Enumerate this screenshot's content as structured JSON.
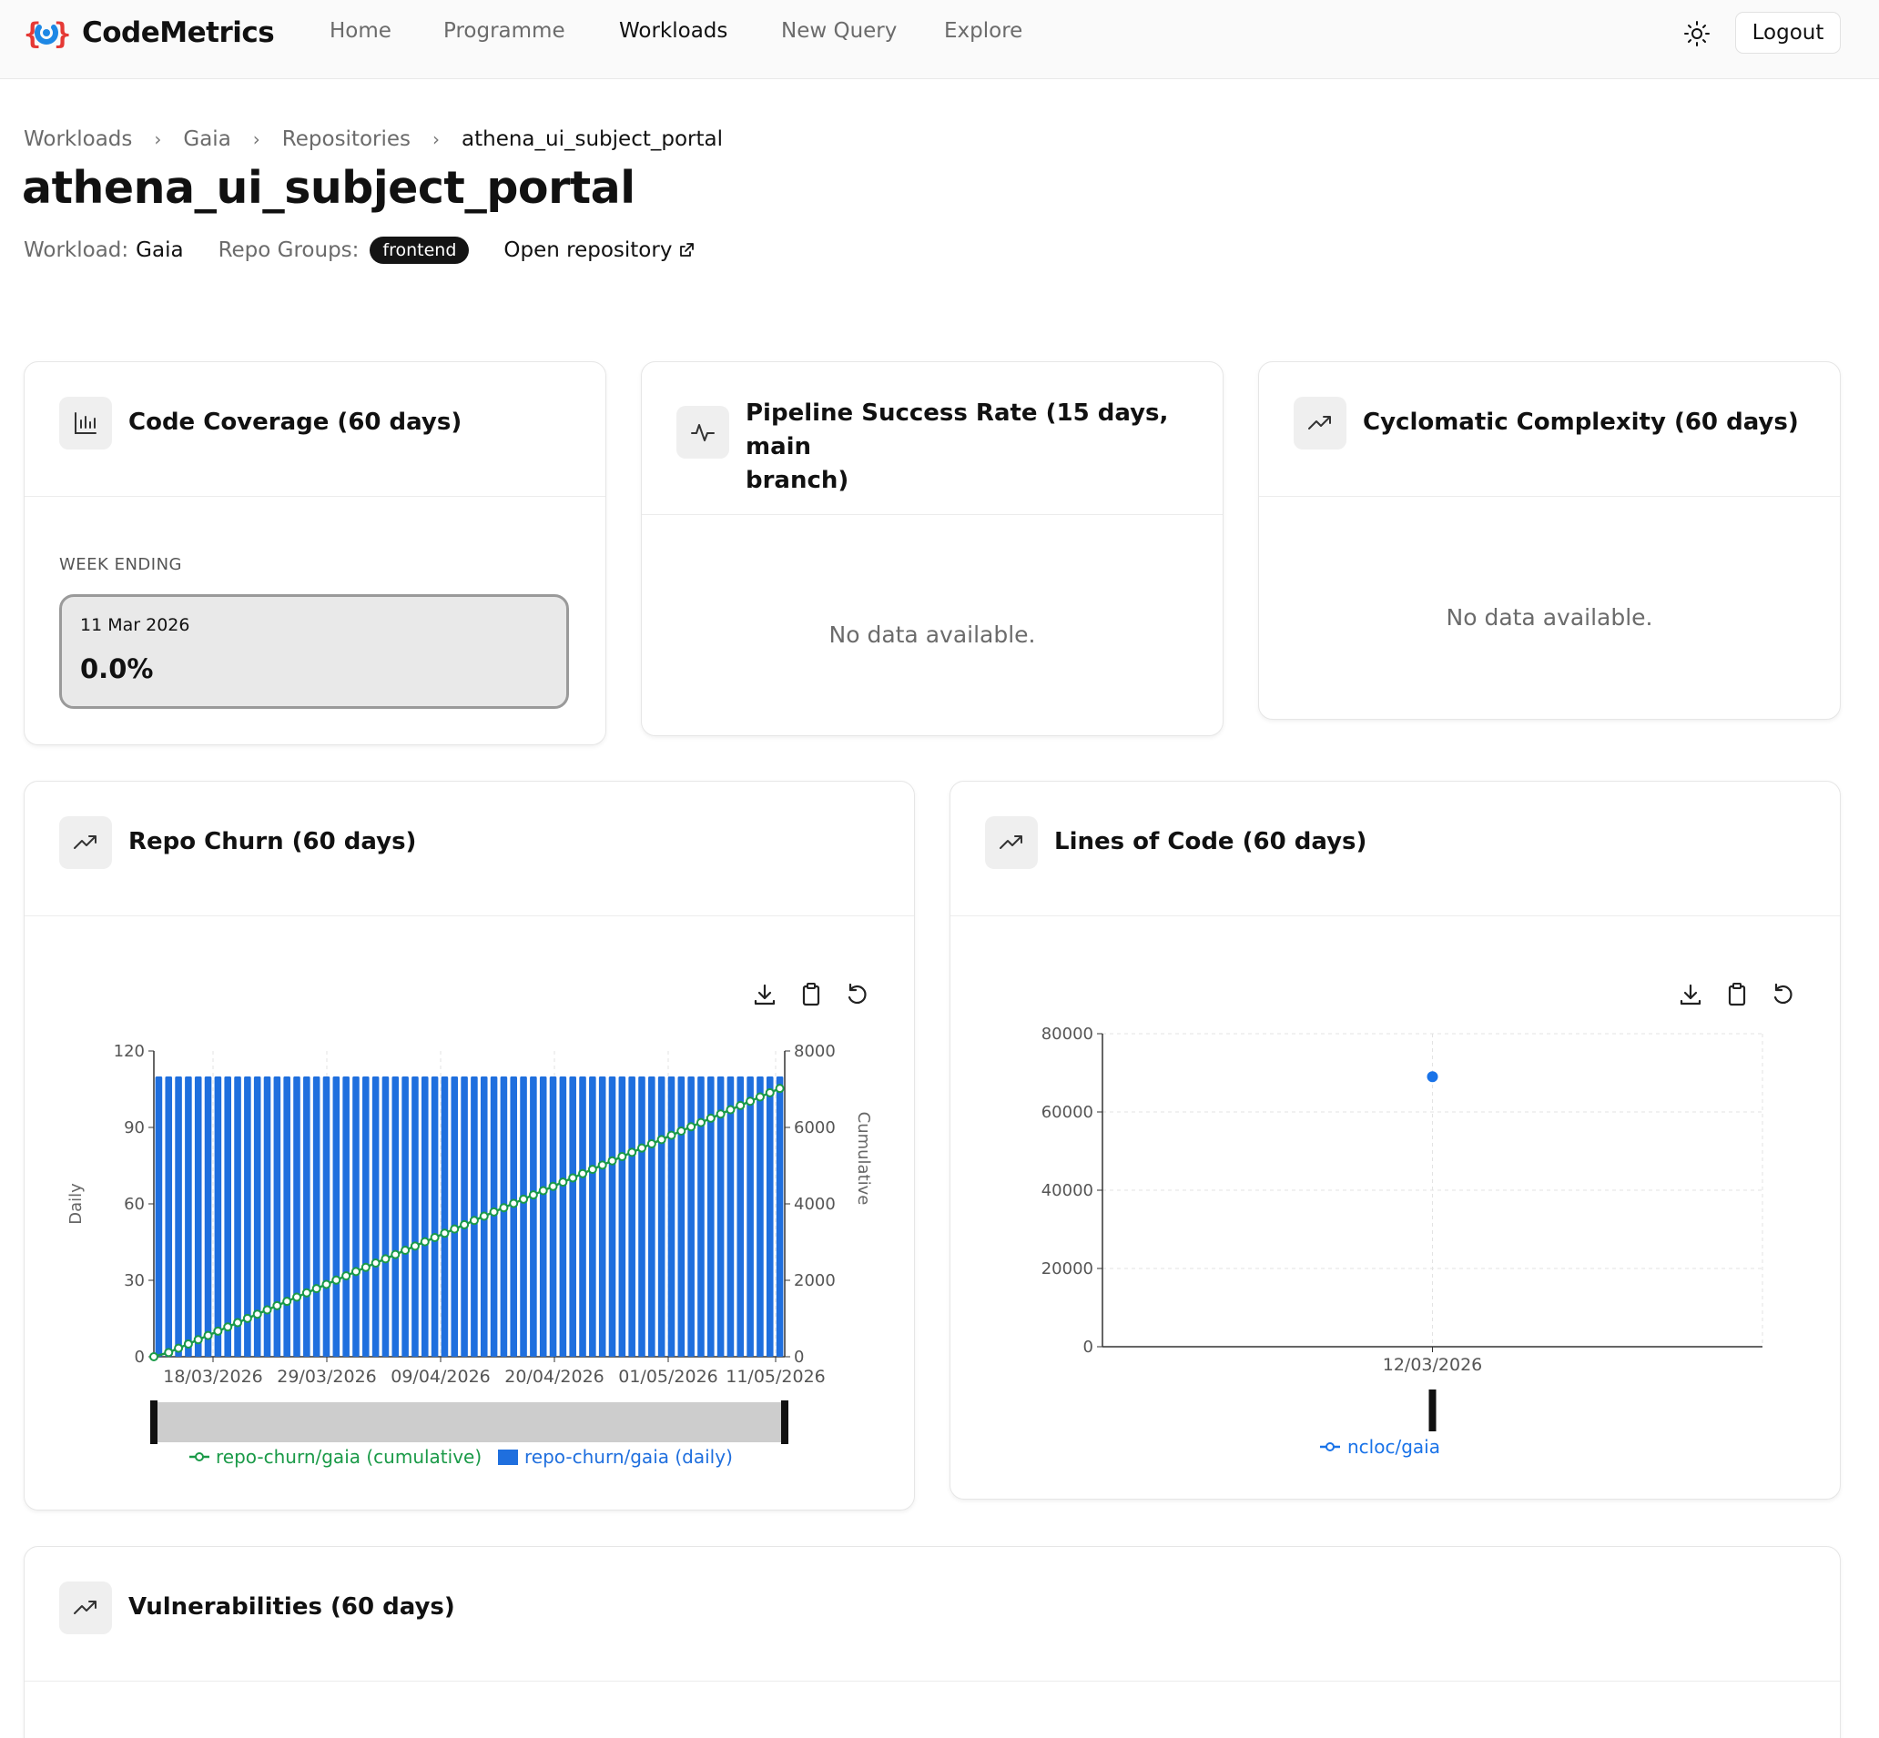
{
  "app": {
    "name": "CodeMetrics"
  },
  "nav": {
    "items": [
      "Home",
      "Programme",
      "Workloads",
      "New Query",
      "Explore"
    ],
    "active": "Workloads",
    "logout_label": "Logout"
  },
  "breadcrumb": {
    "items": [
      "Workloads",
      "Gaia",
      "Repositories",
      "athena_ui_subject_portal"
    ]
  },
  "page": {
    "title": "athena_ui_subject_portal",
    "workload_label": "Workload:",
    "workload_value": "Gaia",
    "repo_groups_label": "Repo Groups:",
    "repo_group_badge": "frontend",
    "open_repo_label": "Open repository"
  },
  "cards": {
    "coverage": {
      "title": "Code Coverage (60 days)",
      "week_label": "WEEK ENDING",
      "date": "11 Mar 2026",
      "value": "0.0%"
    },
    "pipeline": {
      "title_line1": "Pipeline Success Rate (15 days, main",
      "title_line2": "branch)",
      "empty": "No data available."
    },
    "complexity": {
      "title": "Cyclomatic Complexity (60 days)",
      "empty": "No data available."
    },
    "churn": {
      "title": "Repo Churn (60 days)"
    },
    "loc": {
      "title": "Lines of Code (60 days)"
    },
    "vulns": {
      "title": "Vulnerabilities (60 days)"
    }
  },
  "colors": {
    "bar": "#1f6fde",
    "line": "#1a9a48",
    "point": "#1a73e8"
  },
  "icons": {
    "chart": "bar-chart-icon",
    "activity": "activity-icon",
    "trend": "trending-up-icon",
    "download": "download-icon",
    "clipboard": "clipboard-icon",
    "reset": "reset-icon",
    "theme": "sun-icon",
    "external": "external-link-icon"
  },
  "chart_data": [
    {
      "type": "bar",
      "id": "repo-churn",
      "ylabel_left": "Daily",
      "ylabel_right": "Cumulative",
      "ylim_left": [
        0,
        120
      ],
      "yticks_left": [
        "0",
        "30",
        "60",
        "90",
        "120"
      ],
      "ylim_right": [
        0,
        8000
      ],
      "yticks_right": [
        "0",
        "2000",
        "4000",
        "6000",
        "8000"
      ],
      "xtick_labels": [
        "18/03/2026",
        "29/03/2026",
        "09/04/2026",
        "20/04/2026",
        "01/05/2026",
        "11/05/2026"
      ],
      "grid": true,
      "legend_position": "bottom",
      "days": 64,
      "series": [
        {
          "name": "repo-churn/gaia (cumulative)",
          "kind": "line",
          "axis": "right",
          "start": 0,
          "end": 7020
        },
        {
          "name": "repo-churn/gaia (daily)",
          "kind": "bar",
          "axis": "left",
          "value": 110
        }
      ]
    },
    {
      "type": "scatter",
      "id": "lines-of-code",
      "ylim": [
        0,
        80000
      ],
      "yticks": [
        "0",
        "20000",
        "40000",
        "60000",
        "80000"
      ],
      "x": [
        "12/03/2026"
      ],
      "grid": true,
      "legend_position": "bottom",
      "series": [
        {
          "name": "ncloc/gaia",
          "values": [
            69000
          ]
        }
      ]
    }
  ]
}
